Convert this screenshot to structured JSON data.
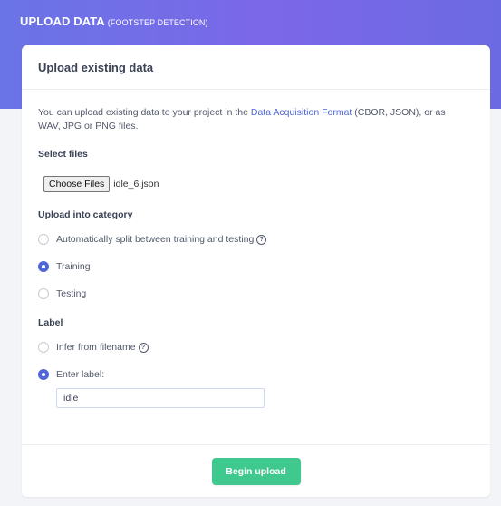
{
  "header": {
    "title": "UPLOAD DATA",
    "subtitle": "(FOOTSTEP DETECTION)"
  },
  "card": {
    "title": "Upload existing data",
    "intro": {
      "before_link": "You can upload existing data to your project in the ",
      "link_text": "Data Acquisition Format",
      "after_link": " (CBOR, JSON), or as WAV, JPG or PNG files."
    },
    "select_files": {
      "label": "Select files",
      "button_label": "Choose Files",
      "file_name": "idle_6.json"
    },
    "category": {
      "label": "Upload into category",
      "options": [
        {
          "label": "Automatically split between training and testing",
          "selected": false,
          "has_help": true
        },
        {
          "label": "Training",
          "selected": true,
          "has_help": false
        },
        {
          "label": "Testing",
          "selected": false,
          "has_help": false
        }
      ]
    },
    "label_section": {
      "label": "Label",
      "options": [
        {
          "label": "Infer from filename",
          "selected": false,
          "has_help": true
        },
        {
          "label": "Enter label:",
          "selected": true,
          "has_help": false
        }
      ],
      "input_value": "idle"
    },
    "footer": {
      "button_label": "Begin upload"
    }
  },
  "icons": {
    "help": "help-circle-icon",
    "help_glyph": "?"
  },
  "colors": {
    "header_gradient_start": "#6a74e6",
    "header_gradient_end": "#6c6ae3",
    "accent": "#4f66d6",
    "link": "#4e67d6",
    "primary_button": "#40c98f"
  }
}
